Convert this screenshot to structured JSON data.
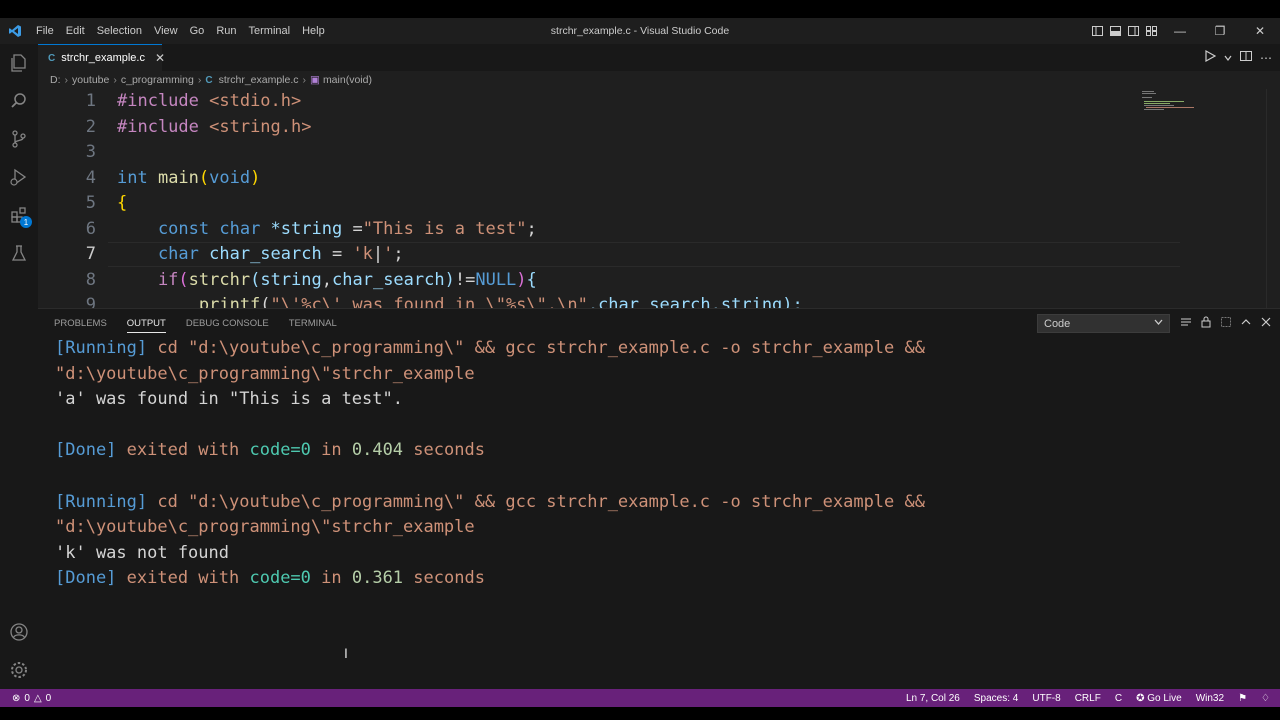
{
  "window": {
    "title": "strchr_example.c - Visual Studio Code"
  },
  "menu": [
    "File",
    "Edit",
    "Selection",
    "View",
    "Go",
    "Run",
    "Terminal",
    "Help"
  ],
  "tab": {
    "label": "strchr_example.c",
    "icon": "C"
  },
  "breadcrumb": [
    "D:",
    "youtube",
    "c_programming",
    "strchr_example.c",
    "main(void)"
  ],
  "editor": {
    "active_line": 7,
    "lines": [
      {
        "n": "1",
        "parts": [
          {
            "t": "#include ",
            "c": "k-macro"
          },
          {
            "t": "<stdio.h>",
            "c": "k-str"
          }
        ]
      },
      {
        "n": "2",
        "parts": [
          {
            "t": "#include ",
            "c": "k-macro"
          },
          {
            "t": "<string.h>",
            "c": "k-str"
          }
        ]
      },
      {
        "n": "3",
        "parts": []
      },
      {
        "n": "4",
        "parts": [
          {
            "t": "int ",
            "c": "k-type"
          },
          {
            "t": "main",
            "c": "k-fn"
          },
          {
            "t": "(",
            "c": "k-brace"
          },
          {
            "t": "void",
            "c": "k-type"
          },
          {
            "t": ")",
            "c": "k-brace"
          }
        ]
      },
      {
        "n": "5",
        "parts": [
          {
            "t": "{",
            "c": "k-brace"
          }
        ]
      },
      {
        "n": "6",
        "parts": [
          {
            "t": "    const ",
            "c": "k-type"
          },
          {
            "t": "char ",
            "c": "k-type"
          },
          {
            "t": "*string",
            "c": "k-var"
          },
          {
            "t": " =",
            "c": "o-white"
          },
          {
            "t": "\"This is a test\"",
            "c": "k-str"
          },
          {
            "t": ";",
            "c": "o-white"
          }
        ]
      },
      {
        "n": "7",
        "parts": [
          {
            "t": "    char ",
            "c": "k-type"
          },
          {
            "t": "char_search",
            "c": "k-var"
          },
          {
            "t": " = ",
            "c": "o-white"
          },
          {
            "t": "'k",
            "c": "k-str"
          },
          {
            "t": "|",
            "c": "o-white"
          },
          {
            "t": "'",
            "c": "k-str"
          },
          {
            "t": ";",
            "c": "o-white"
          }
        ]
      },
      {
        "n": "8",
        "parts": [
          {
            "t": "    if",
            "c": "k-macro"
          },
          {
            "t": "(",
            "c": "k-paren"
          },
          {
            "t": "strchr",
            "c": "k-fn"
          },
          {
            "t": "(",
            "c": "k-var"
          },
          {
            "t": "string",
            "c": "k-var"
          },
          {
            "t": ",",
            "c": "o-white"
          },
          {
            "t": "char_search",
            "c": "k-var"
          },
          {
            "t": ")",
            "c": "k-var"
          },
          {
            "t": "!=",
            "c": "o-white"
          },
          {
            "t": "NULL",
            "c": "k-type"
          },
          {
            "t": ")",
            "c": "k-paren"
          },
          {
            "t": "{",
            "c": "k-var"
          }
        ]
      },
      {
        "n": "9",
        "parts": [
          {
            "t": "        printf",
            "c": "k-fn"
          },
          {
            "t": "(",
            "c": "o-white"
          },
          {
            "t": "\"\\'%c\\' was found in \\\"%s\\\".\\n\"",
            "c": "k-str"
          },
          {
            "t": ",char_search,string);",
            "c": "k-var"
          }
        ]
      }
    ]
  },
  "panel": {
    "tabs": [
      "PROBLEMS",
      "OUTPUT",
      "DEBUG CONSOLE",
      "TERMINAL"
    ],
    "active_tab": "OUTPUT",
    "output_channel": "Code",
    "lines": [
      [
        {
          "t": "[Running]",
          "c": "o-blue"
        },
        {
          "t": " cd \"d:\\youtube\\c_programming\\\" && gcc strchr_example.c -o strchr_example &&",
          "c": "o-orange"
        }
      ],
      [
        {
          "t": "\"d:\\youtube\\c_programming\\\"strchr_example",
          "c": "o-orange"
        }
      ],
      [
        {
          "t": "'a' was found in \"This is a test\".",
          "c": "o-white"
        }
      ],
      [],
      [
        {
          "t": "[Done]",
          "c": "o-blue"
        },
        {
          "t": " exited with ",
          "c": "o-orange"
        },
        {
          "t": "code=0",
          "c": "o-teal"
        },
        {
          "t": " in ",
          "c": "o-orange"
        },
        {
          "t": "0.404",
          "c": "o-green"
        },
        {
          "t": " seconds",
          "c": "o-orange"
        }
      ],
      [],
      [
        {
          "t": "[Running]",
          "c": "o-blue"
        },
        {
          "t": " cd \"d:\\youtube\\c_programming\\\" && gcc strchr_example.c -o strchr_example &&",
          "c": "o-orange"
        }
      ],
      [
        {
          "t": "\"d:\\youtube\\c_programming\\\"strchr_example",
          "c": "o-orange"
        }
      ],
      [
        {
          "t": "'k' was not found",
          "c": "o-white"
        }
      ],
      [
        {
          "t": "[Done]",
          "c": "o-blue"
        },
        {
          "t": " exited with ",
          "c": "o-orange"
        },
        {
          "t": "code=0",
          "c": "o-teal"
        },
        {
          "t": " in ",
          "c": "o-orange"
        },
        {
          "t": "0.361",
          "c": "o-green"
        },
        {
          "t": " seconds",
          "c": "o-orange"
        }
      ]
    ]
  },
  "statusbar": {
    "errors": "0",
    "warnings": "0",
    "position": "Ln 7, Col 26",
    "spaces": "Spaces: 4",
    "encoding": "UTF-8",
    "eol": "CRLF",
    "language": "C",
    "golive": "Go Live",
    "platform": "Win32"
  },
  "activity": {
    "extensions_badge": "1"
  },
  "colors": {
    "statusbar": "#68217a",
    "accent": "#0078d4"
  }
}
